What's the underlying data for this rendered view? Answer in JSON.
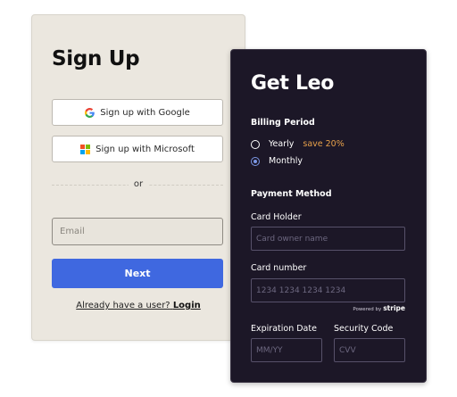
{
  "signup": {
    "title": "Sign Up",
    "google_label": "Sign up with Google",
    "microsoft_label": "Sign up with Microsoft",
    "divider_text": "or",
    "email_placeholder": "Email",
    "next_label": "Next",
    "login_prefix": "Already have a user?",
    "login_link": "Login"
  },
  "checkout": {
    "title": "Get Leo",
    "billing_period_label": "Billing Period",
    "plans": [
      {
        "label": "Yearly",
        "badge": "save 20%",
        "selected": false
      },
      {
        "label": "Monthly",
        "selected": true
      }
    ],
    "payment_method_label": "Payment Method",
    "card_holder_label": "Card Holder",
    "card_holder_placeholder": "Card owner name",
    "card_number_label": "Card number",
    "card_number_placeholder": "1234 1234 1234 1234",
    "powered_by": "Powered by",
    "stripe_label": "stripe",
    "expiration_label": "Expiration Date",
    "expiration_placeholder": "MM/YY",
    "security_label": "Security Code",
    "security_placeholder": "CVV"
  },
  "icons": {
    "google": "google-icon",
    "microsoft": "microsoft-icon"
  },
  "colors": {
    "signup_background": "#ebe7df",
    "next_button": "#3f68e0",
    "checkout_background": "#1c1727",
    "save_badge": "#e7a04a",
    "radio_selected": "#7c98e6"
  }
}
